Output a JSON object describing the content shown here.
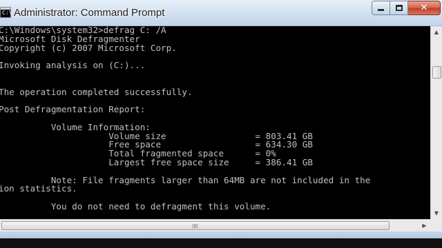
{
  "window": {
    "title": "Administrator: Command Prompt",
    "app_icon_text": "C:\\",
    "icons": {
      "app": "command-prompt-icon",
      "minimize": "minimize-icon",
      "maximize": "maximize-icon",
      "close": "close-icon"
    },
    "close_glyph": "✕"
  },
  "console": {
    "lines": [
      "C:\\Windows\\system32>defrag C: /A",
      "Microsoft Disk Defragmenter",
      "Copyright (c) 2007 Microsoft Corp.",
      "",
      "Invoking analysis on (C:)...",
      "",
      "",
      "The operation completed successfully.",
      "",
      "Post Defragmentation Report:",
      "",
      "          Volume Information:",
      "                     Volume size                 = 803.41 GB",
      "                     Free space                  = 634.30 GB",
      "                     Total fragmented space      = 0%",
      "                     Largest free space size     = 386.41 GB",
      "",
      "          Note: File fragments larger than 64MB are not included in the",
      "ion statistics.",
      "",
      "          You do not need to defragment this volume."
    ]
  },
  "scrollbars": {
    "up_arrow": "▲",
    "down_arrow": "▼",
    "left_arrow": "◀",
    "right_arrow": "▶"
  },
  "colors": {
    "console_background": "#000000",
    "console_text": "#c0c0c0",
    "close_button": "#c7432c"
  }
}
